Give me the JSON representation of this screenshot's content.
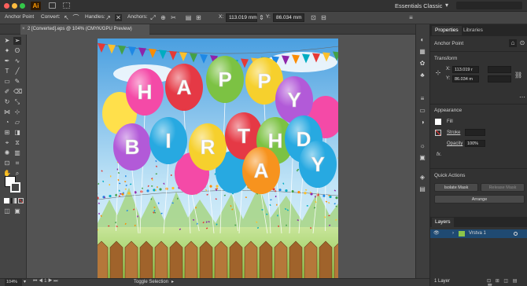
{
  "app": {
    "logo": "Ai",
    "workspace": "Essentials Classic"
  },
  "control_bar": {
    "anchor_point_label": "Anchor Point",
    "convert_label": "Convert:",
    "handles_label": "Handles:",
    "anchors_label": "Anchors:",
    "x_label": "X:",
    "x_value": "113.019 mm",
    "y_label": "Y:",
    "y_value": "86.034 mm"
  },
  "document": {
    "tab_title": "2 [Converted].eps @ 104% (CMYK/GPU Preview)"
  },
  "status": {
    "zoom": "104%",
    "tool_name": "Toggle Selection"
  },
  "panel": {
    "tabs": [
      "Properties",
      "Libraries"
    ],
    "section_anchor": "Anchor Point",
    "transform_title": "Transform",
    "x_label": "X:",
    "x_value": "113.019 r",
    "y_label": "Y:",
    "y_value": "86.034 m",
    "appearance_title": "Appearance",
    "fill_label": "Fill",
    "stroke_label": "Stroke",
    "opacity_label": "Opacity",
    "opacity_value": "100%",
    "fx_label": "fx.",
    "quick_actions_title": "Quick Actions",
    "isolate_mask": "Isolate Mask",
    "release_mask": "Release Mask",
    "arrange": "Arrange"
  },
  "layers": {
    "title": "Layers",
    "layer_name": "Vrstva 1",
    "footer": "1 Layer"
  },
  "artwork": {
    "balloon_letters": [
      "H",
      "A",
      "P",
      "P",
      "Y",
      "B",
      "I",
      "R",
      "T",
      "H",
      "D",
      "A",
      "Y"
    ]
  },
  "colors": {
    "accent": "#2c7ad6",
    "title_bg": "#323232",
    "panel_bg": "#323232",
    "canvas_bg": "#535353"
  }
}
